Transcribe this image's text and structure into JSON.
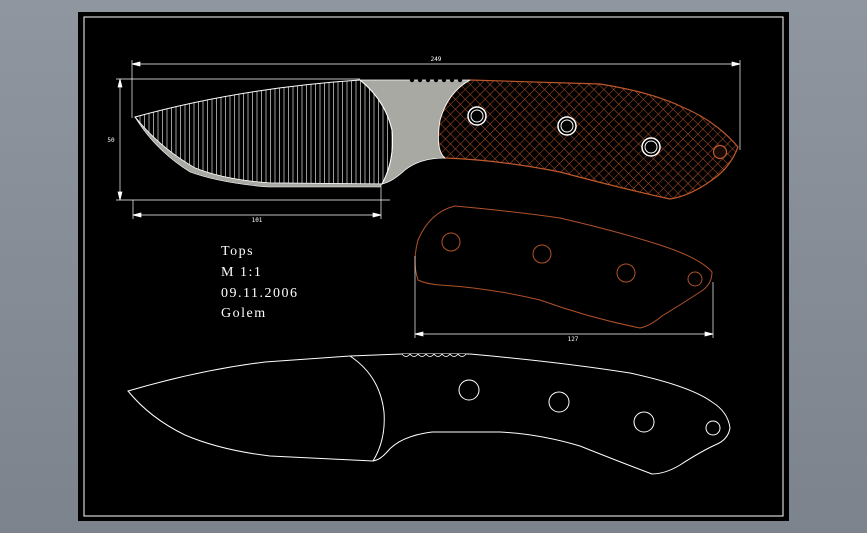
{
  "drawing": {
    "notes": {
      "brand": "Tops",
      "scale": "M 1:1",
      "date": "09.11.2006",
      "author": "Golem"
    },
    "dimensions": {
      "overall_length": "249",
      "blade_height": "50",
      "blade_length": "101",
      "scale_length": "127"
    },
    "colors": {
      "canvas": "#000000",
      "frame": "#ffffff",
      "line": "#ffffff",
      "blade_fill": "#a7a9a2",
      "handle_pattern": "#b0522a",
      "scale_outline": "#b0522a",
      "background": "#878e98"
    }
  }
}
